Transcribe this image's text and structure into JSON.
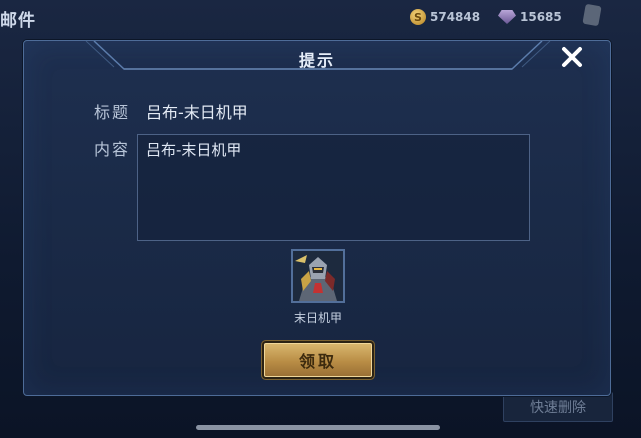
{
  "background": {
    "title": "邮件",
    "gold": "574848",
    "gems": "15685",
    "quick_delete_label": "快速删除"
  },
  "dialog": {
    "title": "提示",
    "subject_label": "标题",
    "subject_value": "吕布-末日机甲",
    "content_label": "内容",
    "content_value": "吕布-末日机甲",
    "reward_item_name": "末日机甲",
    "claim_button_label": "领取"
  },
  "colors": {
    "accent_gold": "#c9a35a",
    "panel_border": "#4e6c98",
    "panel_bg": "#1d2d4c"
  },
  "icons": [
    "coin-icon",
    "gem-icon",
    "bag-icon",
    "close-icon",
    "mech-skin-icon"
  ]
}
